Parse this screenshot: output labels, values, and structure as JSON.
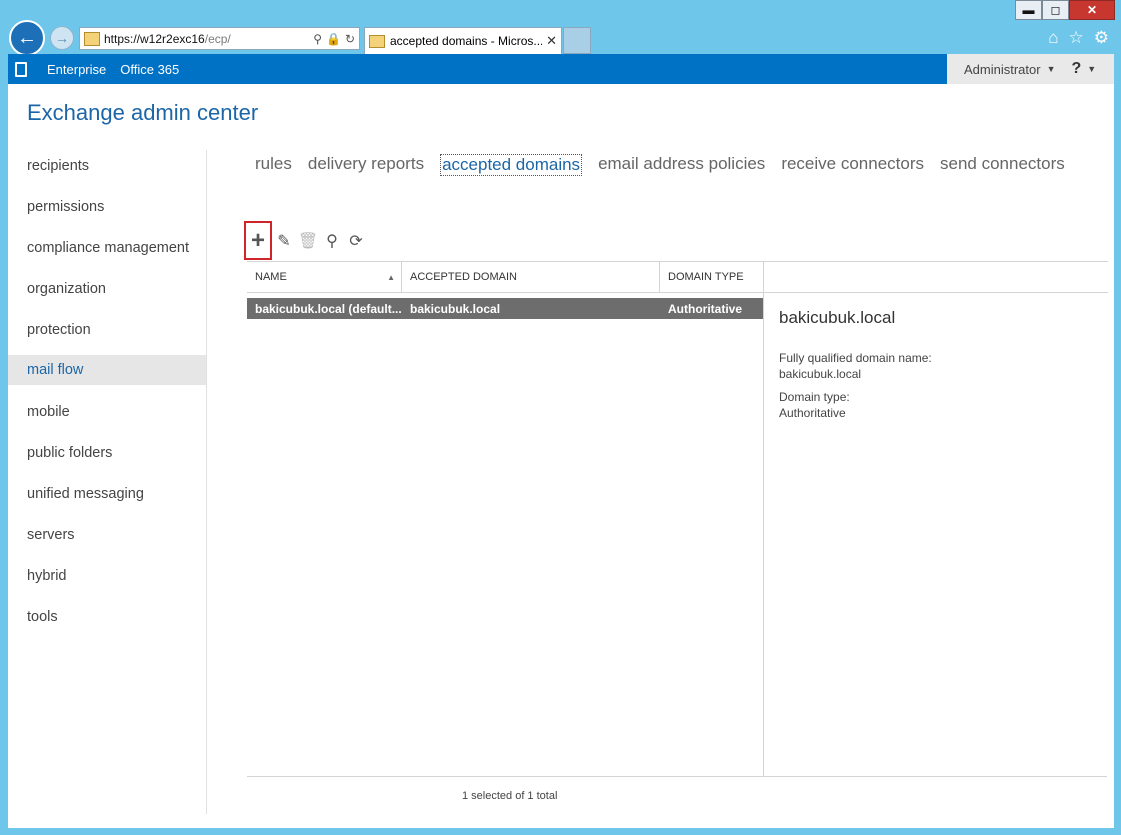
{
  "browser": {
    "url_host": "https://w12r2exc16",
    "url_path": "/ecp/",
    "tab_title": "accepted domains - Micros...",
    "window_controls": {
      "minimize": "▬",
      "maximize": "◻",
      "close": "✕"
    }
  },
  "header": {
    "links": [
      "Enterprise",
      "Office 365"
    ],
    "user": "Administrator",
    "help": "?"
  },
  "app_title": "Exchange admin center",
  "sidebar": {
    "items": [
      {
        "label": "recipients"
      },
      {
        "label": "permissions"
      },
      {
        "label": "compliance management"
      },
      {
        "label": "organization"
      },
      {
        "label": "protection"
      },
      {
        "label": "mail flow"
      },
      {
        "label": "mobile"
      },
      {
        "label": "public folders"
      },
      {
        "label": "unified messaging"
      },
      {
        "label": "servers"
      },
      {
        "label": "hybrid"
      },
      {
        "label": "tools"
      }
    ],
    "active": "mail flow"
  },
  "subtabs": {
    "items": [
      {
        "label": "rules"
      },
      {
        "label": "delivery reports"
      },
      {
        "label": "accepted domains"
      },
      {
        "label": "email address policies"
      },
      {
        "label": "receive connectors"
      },
      {
        "label": "send connectors"
      }
    ],
    "active": "accepted domains"
  },
  "toolbar": {
    "add": "+",
    "edit": "✎",
    "delete": "🗑",
    "search": "⚲",
    "refresh": "⟳"
  },
  "grid": {
    "columns": [
      "NAME",
      "ACCEPTED DOMAIN",
      "DOMAIN TYPE"
    ],
    "sort_indicator": "▲",
    "rows": [
      {
        "name": "bakicubuk.local (default...",
        "domain": "bakicubuk.local",
        "type": "Authoritative"
      }
    ],
    "status": "1 selected of 1 total"
  },
  "details": {
    "title": "bakicubuk.local",
    "fqdn_label": "Fully qualified domain name:",
    "fqdn_value": "bakicubuk.local",
    "type_label": "Domain type:",
    "type_value": "Authoritative"
  }
}
